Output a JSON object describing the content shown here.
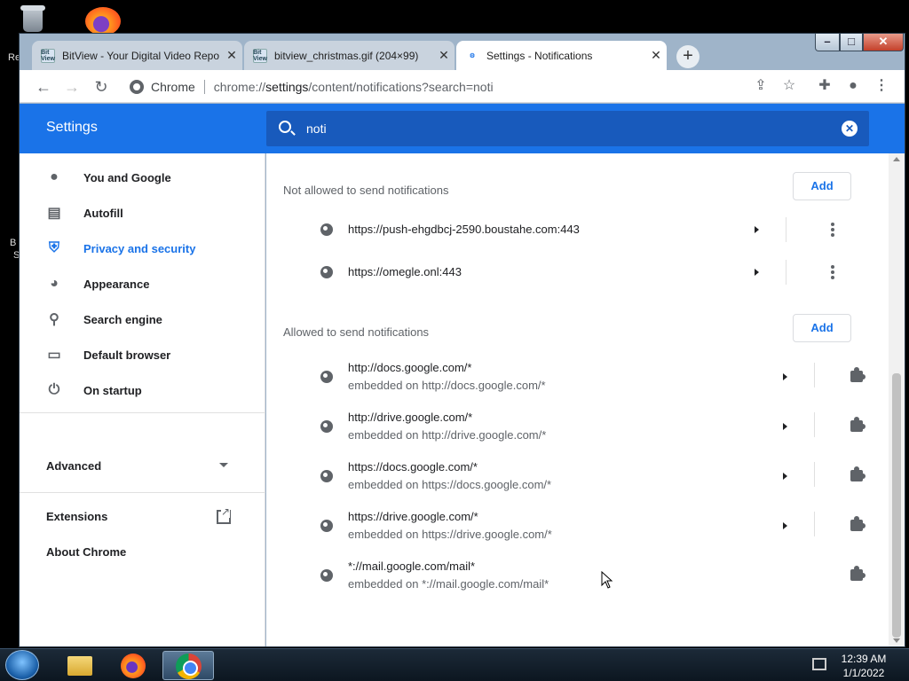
{
  "desktop": {
    "edge_labels": [
      "Re",
      "B",
      "S"
    ]
  },
  "window_controls": {
    "minimize": "–",
    "maximize": "□",
    "close": "✕"
  },
  "tabs": [
    {
      "favicon": "BitView",
      "title": "BitView - Your Digital Video Repo",
      "close": "✕"
    },
    {
      "favicon": "BitView",
      "title": "bitview_christmas.gif (204×99)",
      "close": "✕"
    },
    {
      "favicon": "gear-icon",
      "title": "Settings - Notifications",
      "close": "✕"
    }
  ],
  "new_tab": "+",
  "toolbar": {
    "back": "←",
    "forward": "→",
    "reload": "↻",
    "site_chip": "Chrome",
    "url_prefix": "chrome://",
    "url_host": "settings",
    "url_path": "/content/notifications?search=noti"
  },
  "settings": {
    "title": "Settings",
    "search_value": "noti",
    "search_clear": "✕"
  },
  "sidebar": {
    "items": [
      {
        "label": "You and Google",
        "icon": "person-icon"
      },
      {
        "label": "Autofill",
        "icon": "clipboard-icon"
      },
      {
        "label": "Privacy and security",
        "icon": "shield-icon"
      },
      {
        "label": "Appearance",
        "icon": "palette-icon"
      },
      {
        "label": "Search engine",
        "icon": "search-icon"
      },
      {
        "label": "Default browser",
        "icon": "browser-icon"
      },
      {
        "label": "On startup",
        "icon": "power-icon"
      }
    ],
    "advanced": "Advanced",
    "extensions": "Extensions",
    "about": "About Chrome"
  },
  "content": {
    "blocked": {
      "label": "Not allowed to send notifications",
      "add": "Add",
      "sites": [
        "https://push-ehgdbcj-2590.boustahe.com:443",
        "https://omegle.onl:443"
      ]
    },
    "allowed": {
      "label": "Allowed to send notifications",
      "add": "Add",
      "sites": [
        {
          "url": "http://docs.google.com/*",
          "sub": "embedded on http://docs.google.com/*"
        },
        {
          "url": "http://drive.google.com/*",
          "sub": "embedded on http://drive.google.com/*"
        },
        {
          "url": "https://docs.google.com/*",
          "sub": "embedded on https://docs.google.com/*"
        },
        {
          "url": "https://drive.google.com/*",
          "sub": "embedded on https://drive.google.com/*"
        },
        {
          "url": "*://mail.google.com/mail*",
          "sub": "embedded on *://mail.google.com/mail*"
        }
      ]
    }
  },
  "taskbar": {
    "time": "12:39 AM",
    "date": "1/1/2022"
  }
}
